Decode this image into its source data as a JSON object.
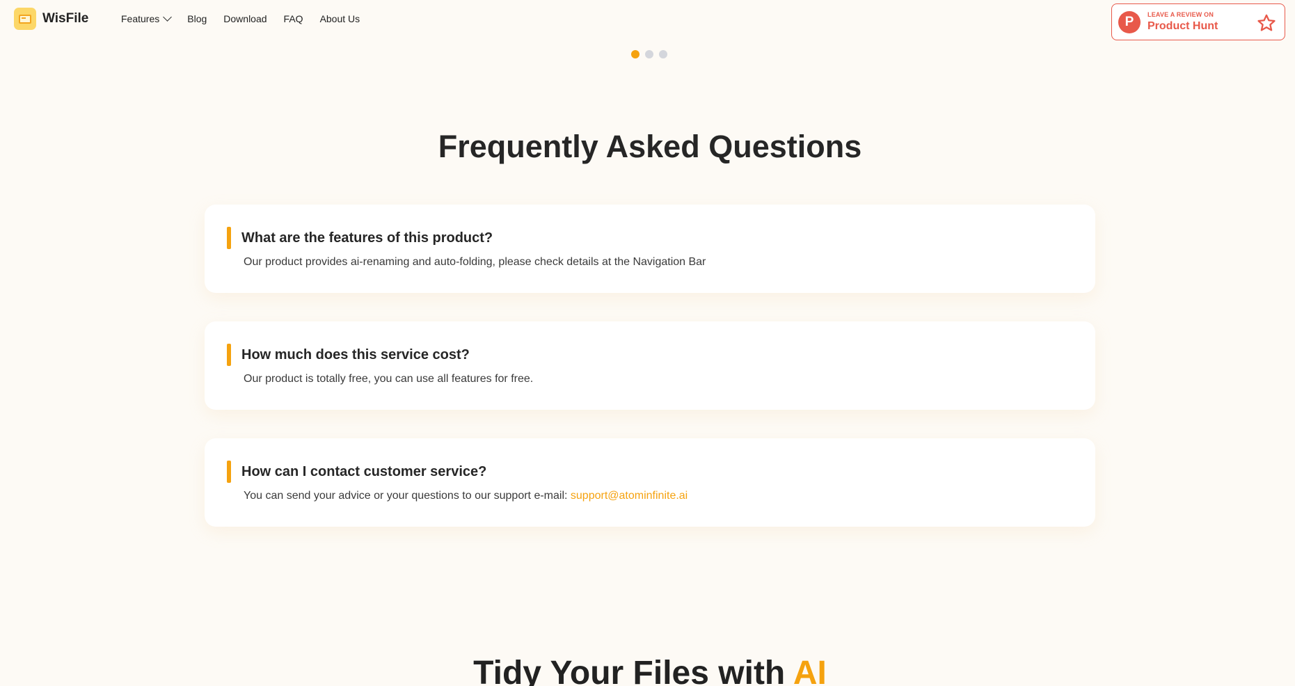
{
  "header": {
    "logo_text": "WisFile",
    "nav": [
      {
        "label": "Features",
        "has_dropdown": true
      },
      {
        "label": "Blog"
      },
      {
        "label": "Download"
      },
      {
        "label": "FAQ"
      },
      {
        "label": "About Us"
      }
    ],
    "product_hunt": {
      "small": "LEAVE A REVIEW ON",
      "big": "Product Hunt",
      "logo_letter": "P",
      "color": "#e8594a"
    }
  },
  "carousel": {
    "dots": 3,
    "active_index": 0,
    "active_color": "#f5a20f"
  },
  "faq": {
    "title": "Frequently Asked Questions",
    "items": [
      {
        "question": "What are the features of this product?",
        "answer": "Our product provides ai-renaming and auto-folding, please check details at the Navigation Bar"
      },
      {
        "question": "How much does this service cost?",
        "answer": "Our product is totally free, you can use all features for free."
      },
      {
        "question": "How can I contact customer service?",
        "answer": "You can send your advice or your questions to our support e-mail: ",
        "email": "support@atominfinite.ai"
      }
    ]
  },
  "next_section": {
    "title_main": "Tidy Your Files with ",
    "title_accent": "AI"
  },
  "colors": {
    "accent": "#f5a20f",
    "background": "#fdfaf5"
  }
}
